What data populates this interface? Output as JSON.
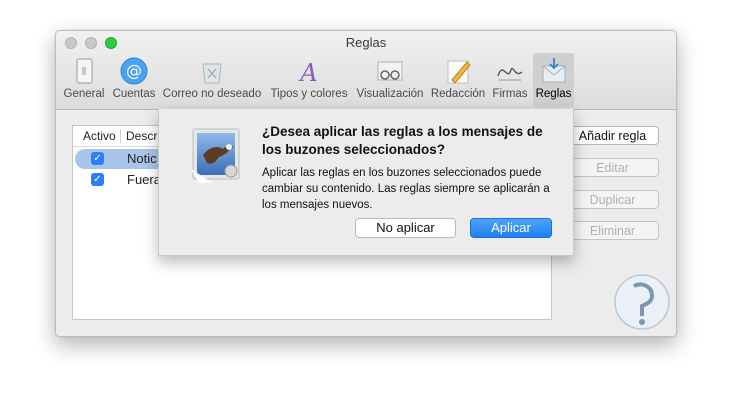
{
  "window": {
    "title": "Reglas"
  },
  "toolbar": {
    "items": [
      {
        "label": "General",
        "icon": "general-icon"
      },
      {
        "label": "Cuentas",
        "icon": "at-icon"
      },
      {
        "label": "Correo no deseado",
        "icon": "junk-icon"
      },
      {
        "label": "Tipos y colores",
        "icon": "font-icon"
      },
      {
        "label": "Visualización",
        "icon": "glasses-icon"
      },
      {
        "label": "Redacción",
        "icon": "pencil-icon"
      },
      {
        "label": "Firmas",
        "icon": "signature-icon"
      },
      {
        "label": "Reglas",
        "icon": "rules-icon",
        "selected": true
      }
    ]
  },
  "rules_list": {
    "columns": [
      "Activo",
      "Descr"
    ],
    "rows": [
      {
        "active": true,
        "name": "Notic",
        "selected": true
      },
      {
        "active": true,
        "name": "Fuera",
        "selected": false
      }
    ]
  },
  "side_buttons": {
    "add": "Añadir regla",
    "edit": "Editar",
    "duplicate": "Duplicar",
    "delete": "Eliminar"
  },
  "dialog": {
    "title": "¿Desea aplicar las reglas a los mensajes de los buzones seleccionados?",
    "message": "Aplicar las reglas en los buzones seleccionados puede cambiar su contenido. Las reglas siempre se aplicarán a los mensajes nuevos.",
    "cancel_label": "No aplicar",
    "apply_label": "Aplicar"
  },
  "colors": {
    "accent": "#2d7ff9",
    "selection": "#a9c5ea",
    "zoom_light": "#2ccb42"
  }
}
